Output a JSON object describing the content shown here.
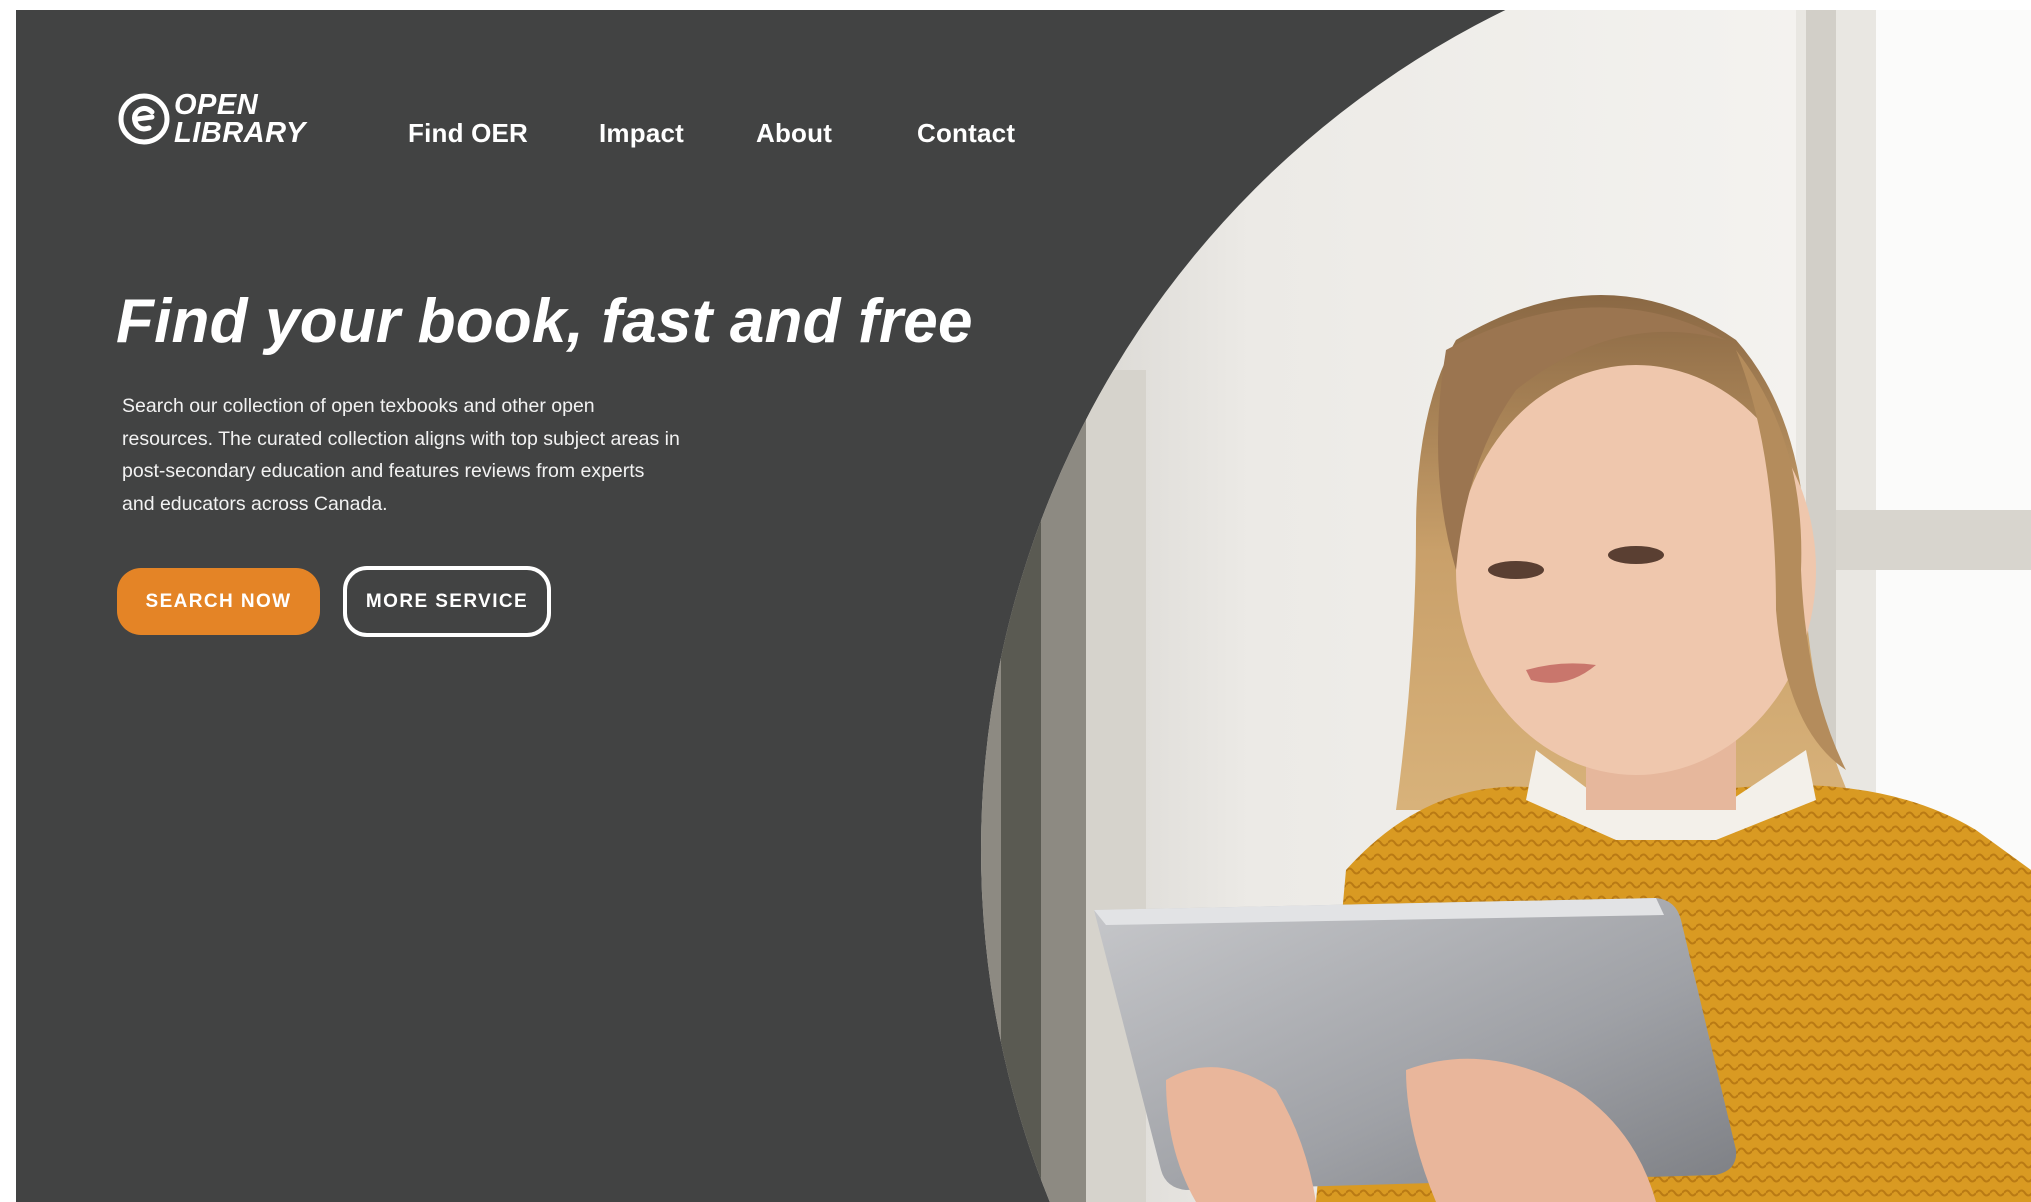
{
  "brand": {
    "line1": "OPEN",
    "line2": "LIBRARY",
    "logo_icon": "copyright-style-e-icon"
  },
  "nav": {
    "items": [
      {
        "label": "Find OER"
      },
      {
        "label": "Impact"
      },
      {
        "label": "About"
      },
      {
        "label": "Contact"
      }
    ]
  },
  "hero": {
    "title": "Find your book, fast and free",
    "body": "Search our collection of open texbooks and other open resources. The curated collection aligns with top subject areas in post-secondary education and features reviews from experts and educators across Canada.",
    "primary_button": "SEARCH NOW",
    "secondary_button": "MORE SERVICE",
    "image_alt": "Woman in a mustard sweater reading on a tablet by a window"
  },
  "colors": {
    "background": "#424343",
    "accent": "#e48426",
    "text": "#ffffff"
  }
}
